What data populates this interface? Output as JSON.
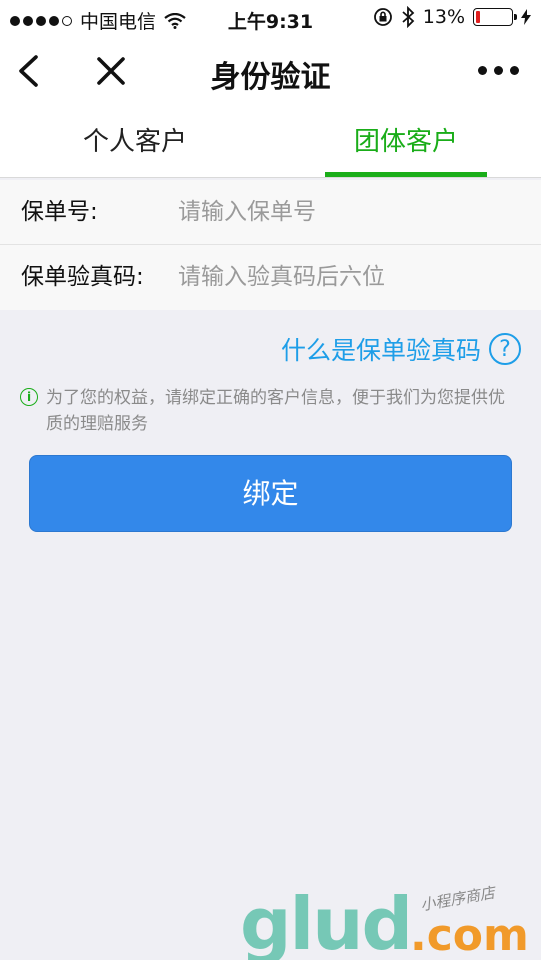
{
  "status_bar": {
    "carrier": "中国电信",
    "time": "上午9:31",
    "battery": "13%",
    "battery_level": 0.13
  },
  "nav": {
    "title": "身份验证"
  },
  "tabs": [
    {
      "label": "个人客户",
      "active": false
    },
    {
      "label": "团体客户",
      "active": true
    }
  ],
  "form": {
    "policy_no": {
      "label": "保单号:",
      "placeholder": "请输入保单号"
    },
    "verify_code": {
      "label": "保单验真码:",
      "placeholder": "请输入验真码后六位"
    }
  },
  "help_link": {
    "label": "什么是保单验真码"
  },
  "notice": {
    "text": "为了您的权益，请绑定正确的客户信息，便于我们为您提供优质的理赔服务"
  },
  "bind_button": {
    "label": "绑定"
  },
  "watermark": {
    "main": "glud",
    "suffix": ".com",
    "tag": "小程序商店"
  },
  "colors": {
    "accent_green": "#1aad19",
    "link_blue": "#1e9ee8",
    "button_blue": "#3388ea",
    "battery_red": "#e02020"
  },
  "icons": {
    "back": "chevron-left-icon",
    "close": "close-icon",
    "more": "more-dots-icon",
    "wifi": "wifi-icon",
    "lock_rotation": "rotation-lock-icon",
    "bluetooth": "bluetooth-icon",
    "help": "question-circle-icon",
    "info": "info-circle-icon"
  }
}
